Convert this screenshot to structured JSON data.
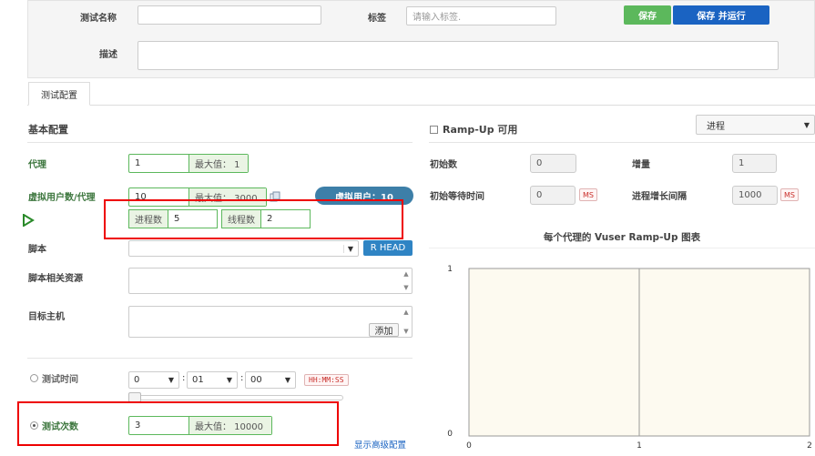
{
  "header": {
    "test_name_label": "测试名称",
    "test_name_value": "",
    "tags_label": "标签",
    "tags_placeholder": "请输入标签.",
    "save_label": "保存",
    "save_run_label": "保存 并运行",
    "description_label": "描述",
    "description_value": ""
  },
  "tabs": [
    {
      "label": "测试配置",
      "active": true
    }
  ],
  "basic": {
    "title": "基本配置",
    "agent_label": "代理",
    "agent_value": "1",
    "agent_max": "最大值： 1",
    "vusers_label": "虚拟用户数/代理",
    "vusers_value": "10",
    "vusers_max": "最大值： 3000",
    "vusers_badge": "虚拟用户：10",
    "process_label": "进程数",
    "process_value": "5",
    "thread_label": "线程数",
    "thread_value": "2",
    "script_label": "脚本",
    "script_value": "",
    "r_head_label": "R HEAD",
    "script_resources_label": "脚本相关资源",
    "target_host_label": "目标主机",
    "add_label": "添加",
    "duration_label": "测试时间",
    "duration_selected": false,
    "hours": "0",
    "minutes": "01",
    "seconds": "00",
    "time_format": "HH:MM:SS",
    "runcount_label": "测试次数",
    "runcount_selected": true,
    "runcount_value": "3",
    "runcount_max": "最大值： 10000",
    "advanced_link": "显示高级配置"
  },
  "rampup": {
    "enable_label": "Ramp-Up 可用",
    "enabled": false,
    "mode_value": "进程",
    "initial_label": "初始数",
    "initial_value": "0",
    "increment_label": "增量",
    "increment_value": "1",
    "initial_wait_label": "初始等待时间",
    "initial_wait_value": "0",
    "interval_label": "进程增长间隔",
    "interval_value": "1000",
    "ms_unit": "MS"
  },
  "chart_data": {
    "type": "line",
    "title": "每个代理的 Vuser Ramp-Up 图表",
    "xlabel": "",
    "ylabel": "",
    "x_ticks": [
      "0",
      "1",
      "2"
    ],
    "y_ticks": [
      "0",
      "1"
    ],
    "xlim": [
      0,
      2
    ],
    "ylim": [
      0,
      1
    ],
    "series": [],
    "background": "#fdfaf0"
  },
  "colors": {
    "green": "#5cb85c",
    "blue": "#1a63c2",
    "teal_badge": "#3d7fa8",
    "red_annotation": "#e00000"
  },
  "icons": {
    "cursor": "cursor-arrow-icon",
    "copy": "copy-icon"
  }
}
